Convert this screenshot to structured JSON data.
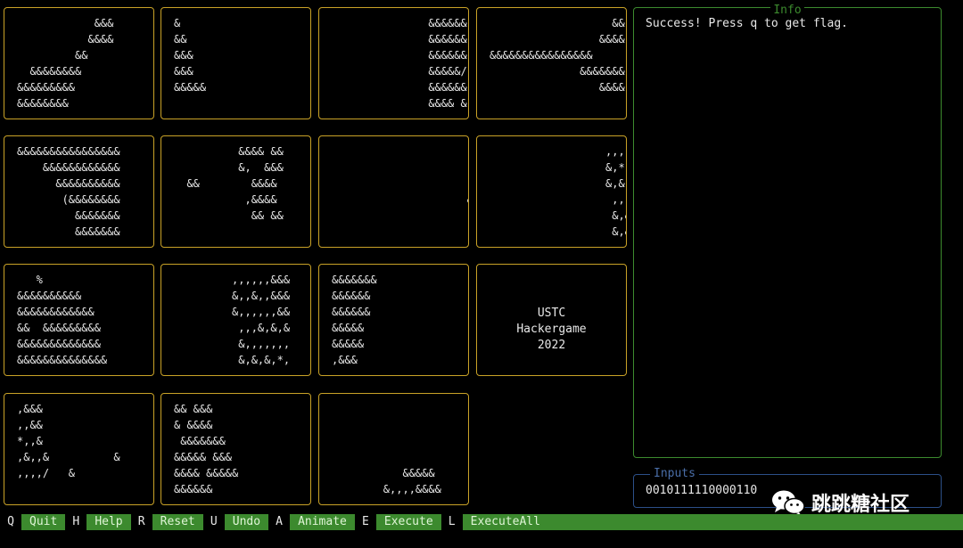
{
  "tiles": [
    "            &&&\n           &&&&\n         &&\n  &&&&&&&&\n&&&&&&&&&\n&&&&&&&&",
    "&\n&&\n&&&\n&&&\n&&&&&",
    "               &&&&&&\n               &&&&&&\n               &&&&&&\n               &&&&&/\n               &&&&&&\n               &&&& &",
    "                   &&\n                 &&&&\n&&&&&&&&&&&&&&&&\n              &&&&&&&\n                 &&&&",
    "&&&&&&&&&&&&&&&&\n    &&&&&&&&&&&&\n      &&&&&&&&&&\n       (&&&&&&&&\n         &&&&&&&\n         &&&&&&&",
    "          &&&& &&\n          &,  &&&\n  &&        &&&&\n           ,&&&&\n            && &&",
    "\n\n\n                     &",
    "                  ,,,,,,&\n                  &,*,&,,\n                  &,&,,,,\n                   ,,,,&,\n                   &,&,,,\n                   &,&",
    "   %\n&&&&&&&&&&\n&&&&&&&&&&&&\n&&  &&&&&&&&&\n&&&&&&&&&&&&&\n&&&&&&&&&&&&&&",
    "         ,,,,,,&&&\n         &,,&,,&&&\n         &,,,,,,&&\n          ,,,&,&,&\n          &,,,,,,,\n          &,&,&,*,",
    "&&&&&&&\n&&&&&&\n&&&&&&\n&&&&&\n&&&&&\n,&&&",
    "USTC\nHackergame\n2022",
    ",&&&\n,,&&\n*,,&\n,&,,&          &\n,,,,/   &",
    "&& &&&\n& &&&&\n &&&&&&&\n&&&&& &&&\n&&&& &&&&&\n&&&&&&",
    "\n\n\n\n           &&&&&\n        &,,,,&&&&"
  ],
  "info": {
    "title": "Info",
    "message": "Success! Press q to get flag."
  },
  "inputs": {
    "title": "Inputs",
    "value": "0010111110000110"
  },
  "watermark": {
    "text": "跳跳糖社区"
  },
  "statusbar": [
    {
      "key": "Q",
      "label": "Quit"
    },
    {
      "key": "H",
      "label": "Help"
    },
    {
      "key": "R",
      "label": "Reset"
    },
    {
      "key": "U",
      "label": "Undo"
    },
    {
      "key": "A",
      "label": "Animate"
    },
    {
      "key": "E",
      "label": "Execute"
    },
    {
      "key": "L",
      "label": "ExecuteAll"
    }
  ],
  "colors": {
    "tile_border": "#c9a227",
    "info_border": "#3c8a2e",
    "inputs_border": "#2c4f88",
    "status_bg": "#3c8a2e"
  }
}
